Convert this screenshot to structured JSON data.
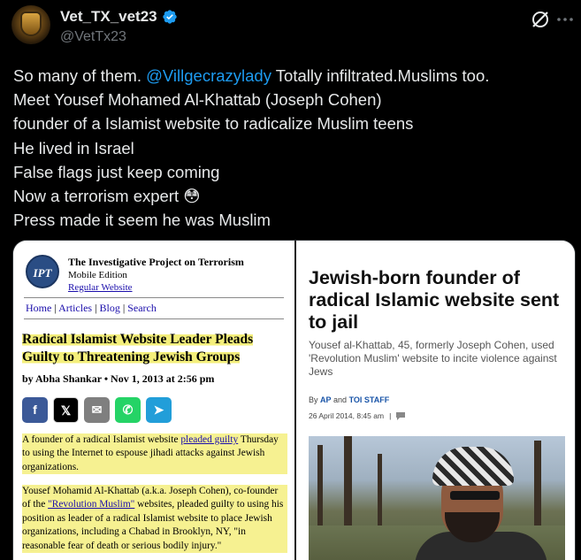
{
  "header": {
    "display_name": "Vet_TX_vet23",
    "handle": "@VetTx23",
    "verified_color": "#1d9bf0"
  },
  "tweet": {
    "line1_pre": "So many of them. ",
    "line1_mention": "@Villgecrazylady",
    "line1_post": " Totally infiltrated.Muslims too.",
    "line2": "Meet Yousef Mohamed Al-Khattab (Joseph Cohen)",
    "line3": "founder of a Islamist website to radicalize Muslim teens",
    "line4": "He lived in Israel",
    "line5": "False flags just keep coming",
    "line6": "Now a terrorism expert",
    "line6_emoji": "😳",
    "line7": "Press made it seem he was Muslim"
  },
  "left_article": {
    "logo_text": "IPT",
    "site_name": "The Investigative Project on Terrorism",
    "edition": "Mobile Edition",
    "regular_link": "Regular Website",
    "nav": [
      "Home",
      "Articles",
      "Blog",
      "Search"
    ],
    "headline_1": "Radical Islamist Website Leader Pleads",
    "headline_2": "Guilty to Threatening Jewish Groups",
    "byline": "by Abha Shankar  •  Nov 1, 2013 at 2:56 pm",
    "share": [
      {
        "icon": "f",
        "color": "#3b5998"
      },
      {
        "icon": "𝕏",
        "color": "#000000"
      },
      {
        "icon": "✉",
        "color": "#7f7f7f"
      },
      {
        "icon": "✆",
        "color": "#25d366"
      },
      {
        "icon": "➤",
        "color": "#229ed9"
      }
    ],
    "p1_a": "A founder of a radical Islamist website ",
    "p1_link": "pleaded guilty",
    "p1_b": " Thursday to using the Internet to espouse jihadi attacks against Jewish organizations.",
    "p2_a": "Yousef Mohamid Al-Khattab (a.k.a. Joseph Cohen), co-founder of the ",
    "p2_link": "\"Revolution Muslim\"",
    "p2_b": " websites, pleaded guilty to using his position as leader of a radical Islamist website to place Jewish organizations, including a Chabad in Brooklyn, NY, \"in reasonable fear of death or serious bodily injury.\""
  },
  "right_article": {
    "headline": "Jewish-born founder of radical Islamic website sent to jail",
    "sub": "Yousef al-Khattab, 45, formerly Joseph Cohen, used 'Revolution Muslim' website to incite violence against Jews",
    "by_pre": "By ",
    "by_ap": "AP",
    "by_and": " and ",
    "by_toi": "TOI STAFF",
    "date": "26 April 2014, 8:45 am",
    "date_sep": "|"
  }
}
